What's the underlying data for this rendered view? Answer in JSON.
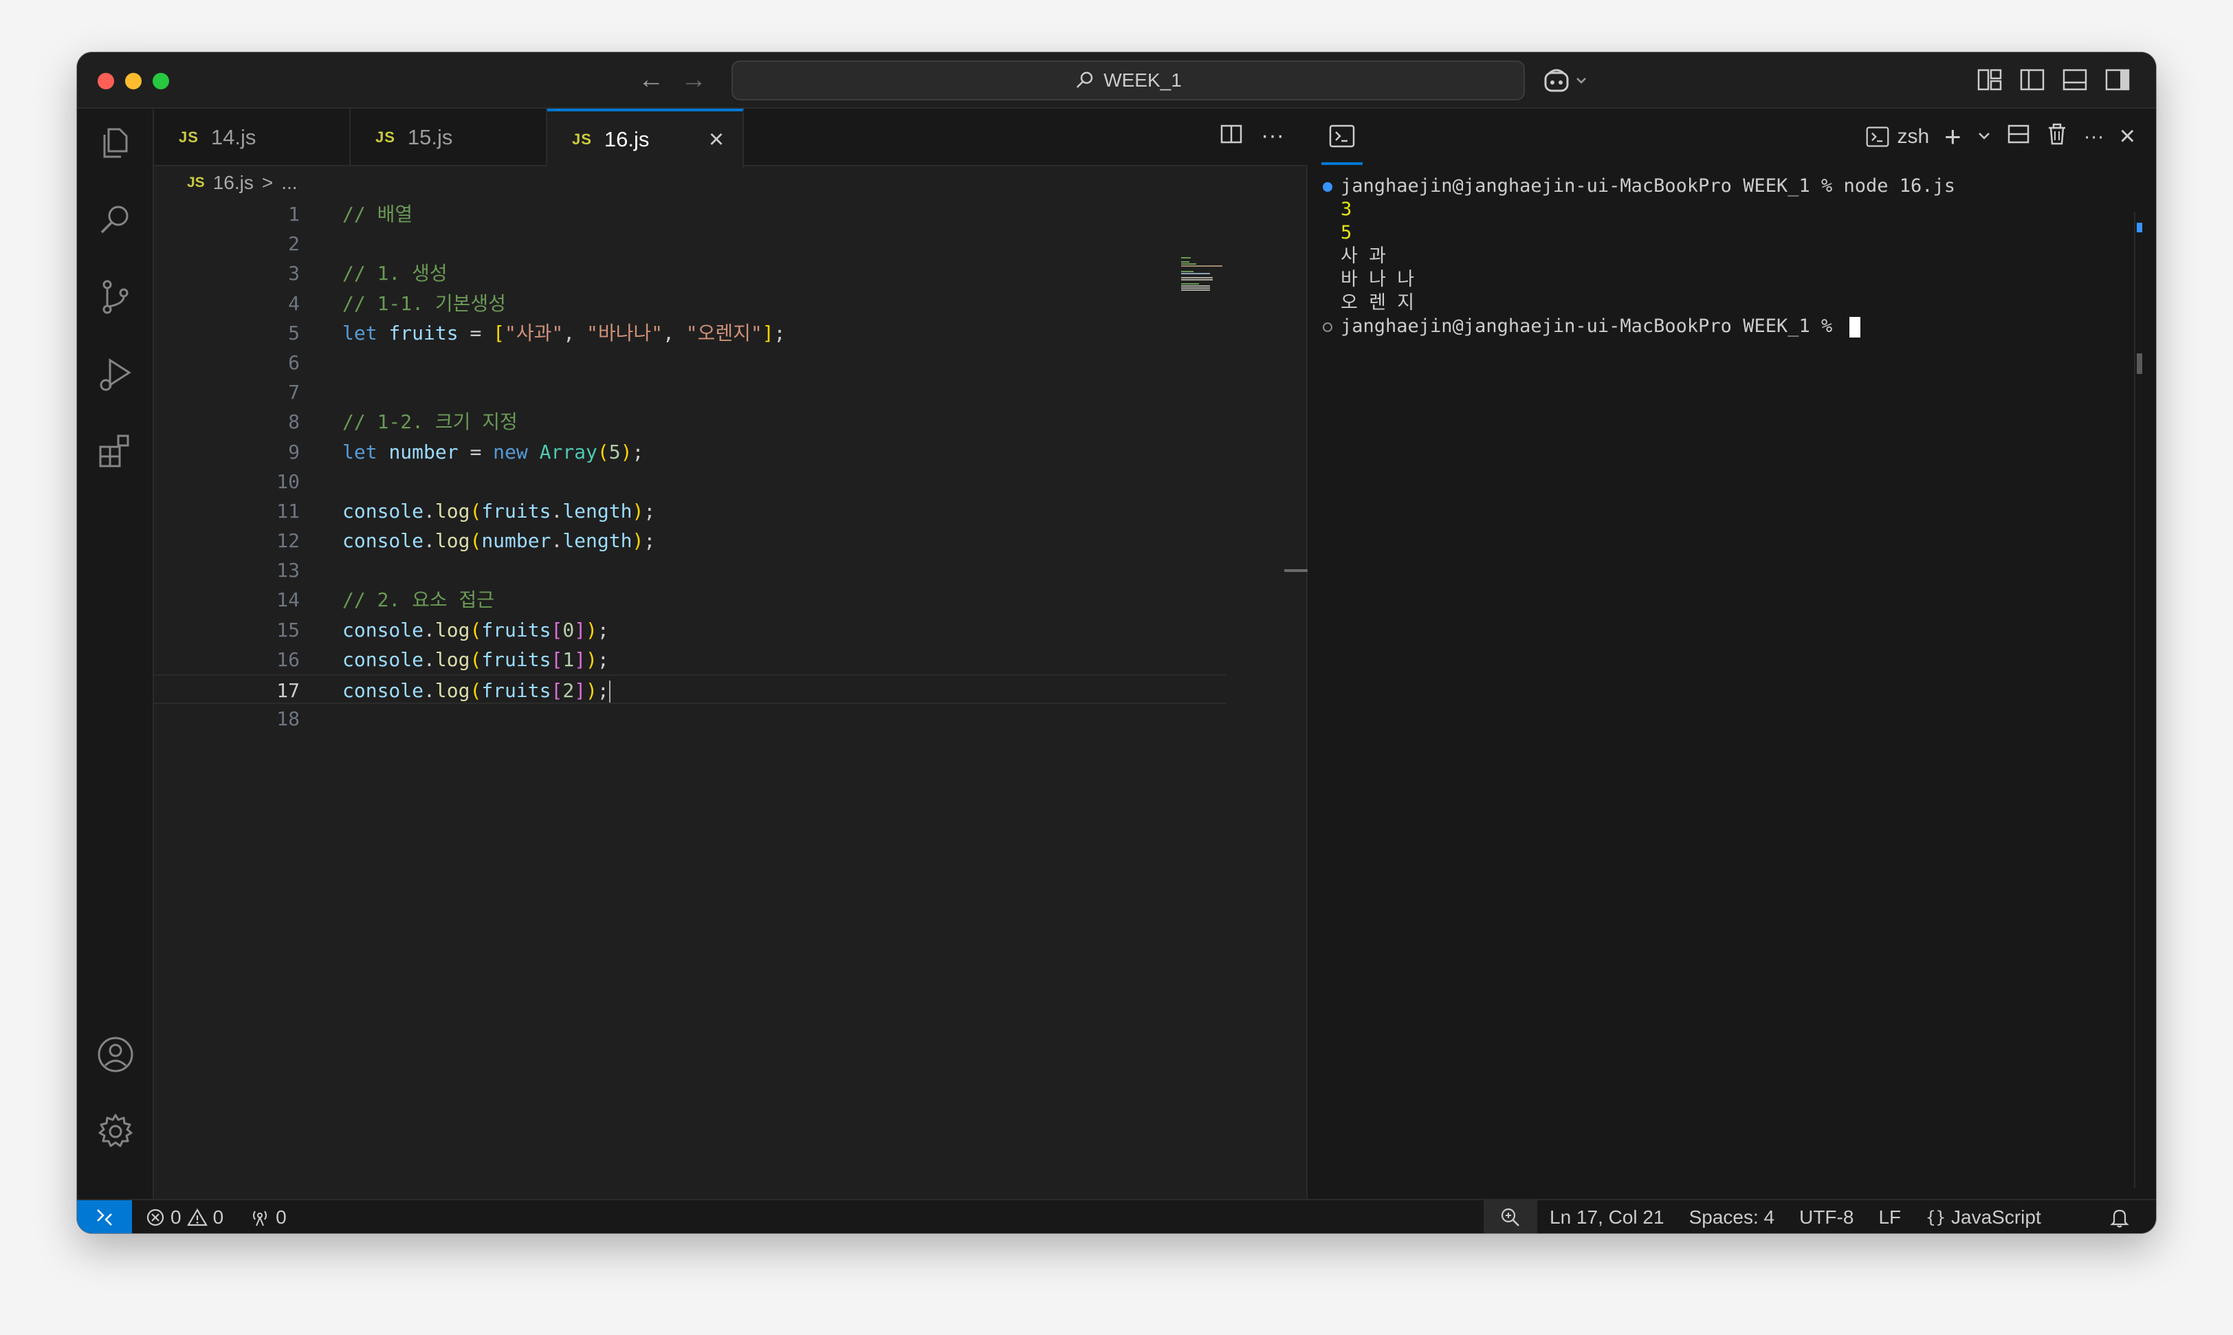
{
  "window": {
    "title": "WEEK_1",
    "colors": {
      "accent": "#0078d4",
      "editor_bg": "#1f1f1f",
      "chrome_bg": "#181818"
    }
  },
  "titlebar": {
    "back_icon": "arrow-left-icon",
    "forward_icon": "arrow-right-icon",
    "search_icon": "search-icon",
    "copilot_icon": "copilot-icon",
    "layout_icons": [
      "customize-layout-icon",
      "toggle-primary-sidebar-icon",
      "toggle-panel-icon",
      "toggle-secondary-sidebar-icon"
    ]
  },
  "activitybar": {
    "items": [
      "explorer-icon",
      "search-icon",
      "source-control-icon",
      "run-and-debug-icon",
      "extensions-icon"
    ],
    "bottom_items": [
      "accounts-icon",
      "manage-gear-icon"
    ]
  },
  "tabs": [
    {
      "badge": "JS",
      "label": "14.js"
    },
    {
      "badge": "JS",
      "label": "15.js"
    },
    {
      "badge": "JS",
      "label": "16.js",
      "active": true
    }
  ],
  "breadcrumb": {
    "badge": "JS",
    "file": "16.js",
    "separator": ">",
    "rest": "..."
  },
  "editor": {
    "current_line": 17,
    "lines": [
      [
        {
          "t": "// 배열",
          "c": "comment"
        }
      ],
      [],
      [
        {
          "t": "// 1. 생성",
          "c": "comment"
        }
      ],
      [
        {
          "t": "// 1-1. 기본생성",
          "c": "comment"
        }
      ],
      [
        {
          "t": "let",
          "c": "kw"
        },
        {
          "t": " "
        },
        {
          "t": "fruits",
          "c": "var"
        },
        {
          "t": " = "
        },
        {
          "t": "[",
          "c": "br1"
        },
        {
          "t": "\"사과\"",
          "c": "str"
        },
        {
          "t": ", "
        },
        {
          "t": "\"바나나\"",
          "c": "str"
        },
        {
          "t": ", "
        },
        {
          "t": "\"오렌지\"",
          "c": "str"
        },
        {
          "t": "]",
          "c": "br1"
        },
        {
          "t": ";"
        }
      ],
      [],
      [],
      [
        {
          "t": "// 1-2. 크기 지정",
          "c": "comment"
        }
      ],
      [
        {
          "t": "let",
          "c": "kw"
        },
        {
          "t": " "
        },
        {
          "t": "number",
          "c": "var"
        },
        {
          "t": " = "
        },
        {
          "t": "new",
          "c": "kw"
        },
        {
          "t": " "
        },
        {
          "t": "Array",
          "c": "cls"
        },
        {
          "t": "(",
          "c": "br1"
        },
        {
          "t": "5",
          "c": "num"
        },
        {
          "t": ")",
          "c": "br1"
        },
        {
          "t": ";"
        }
      ],
      [],
      [
        {
          "t": "console",
          "c": "var"
        },
        {
          "t": "."
        },
        {
          "t": "log",
          "c": "fn"
        },
        {
          "t": "(",
          "c": "br1"
        },
        {
          "t": "fruits",
          "c": "var"
        },
        {
          "t": "."
        },
        {
          "t": "length",
          "c": "var"
        },
        {
          "t": ")",
          "c": "br1"
        },
        {
          "t": ";"
        }
      ],
      [
        {
          "t": "console",
          "c": "var"
        },
        {
          "t": "."
        },
        {
          "t": "log",
          "c": "fn"
        },
        {
          "t": "(",
          "c": "br1"
        },
        {
          "t": "number",
          "c": "var"
        },
        {
          "t": "."
        },
        {
          "t": "length",
          "c": "var"
        },
        {
          "t": ")",
          "c": "br1"
        },
        {
          "t": ";"
        }
      ],
      [],
      [
        {
          "t": "// 2. 요소 접근",
          "c": "comment"
        }
      ],
      [
        {
          "t": "console",
          "c": "var"
        },
        {
          "t": "."
        },
        {
          "t": "log",
          "c": "fn"
        },
        {
          "t": "(",
          "c": "br1"
        },
        {
          "t": "fruits",
          "c": "var"
        },
        {
          "t": "[",
          "c": "br2"
        },
        {
          "t": "0",
          "c": "num"
        },
        {
          "t": "]",
          "c": "br2"
        },
        {
          "t": ")",
          "c": "br1"
        },
        {
          "t": ";"
        }
      ],
      [
        {
          "t": "console",
          "c": "var"
        },
        {
          "t": "."
        },
        {
          "t": "log",
          "c": "fn"
        },
        {
          "t": "(",
          "c": "br1"
        },
        {
          "t": "fruits",
          "c": "var"
        },
        {
          "t": "[",
          "c": "br2"
        },
        {
          "t": "1",
          "c": "num"
        },
        {
          "t": "]",
          "c": "br2"
        },
        {
          "t": ")",
          "c": "br1"
        },
        {
          "t": ";"
        }
      ],
      [
        {
          "t": "console",
          "c": "var"
        },
        {
          "t": "."
        },
        {
          "t": "log",
          "c": "fn"
        },
        {
          "t": "(",
          "c": "br1"
        },
        {
          "t": "fruits",
          "c": "var"
        },
        {
          "t": "[",
          "c": "br2"
        },
        {
          "t": "2",
          "c": "num"
        },
        {
          "t": "]",
          "c": "br2"
        },
        {
          "t": ")",
          "c": "br1"
        },
        {
          "t": ";"
        }
      ],
      []
    ]
  },
  "terminal": {
    "shell_label": "zsh",
    "lines": [
      {
        "marker": "done",
        "text": "janghaejin@janghaejin-ui-MacBookPro WEEK_1 % node 16.js"
      },
      {
        "marker": "none",
        "text": "3",
        "style": "yellow"
      },
      {
        "marker": "none",
        "text": "5",
        "style": "yellow"
      },
      {
        "marker": "none",
        "text": "사 과"
      },
      {
        "marker": "none",
        "text": "바 나 나"
      },
      {
        "marker": "none",
        "text": "오 렌 지"
      },
      {
        "marker": "idle",
        "text": "janghaejin@janghaejin-ui-MacBookPro WEEK_1 % ",
        "cursor": true
      }
    ]
  },
  "statusbar": {
    "errors": "0",
    "warnings": "0",
    "ports": "0",
    "position": "Ln 17, Col 21",
    "indent": "Spaces: 4",
    "encoding": "UTF-8",
    "eol": "LF",
    "language_glyph": "{}",
    "language": "JavaScript"
  }
}
